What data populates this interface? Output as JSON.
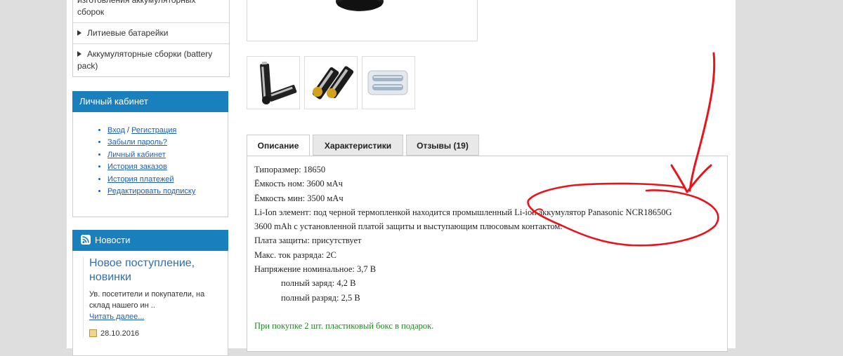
{
  "sidebar": {
    "categories": [
      {
        "label": "изготовления аккумуляторных сборок"
      },
      {
        "label": "Литиевые батарейки"
      },
      {
        "label": "Аккумуляторные сборки (battery pack)"
      }
    ],
    "account": {
      "title": "Личный кабинет",
      "login": "Вход",
      "separator": "/",
      "register": "Регистрация",
      "links": [
        "Забыли пароль?",
        "Личный кабинет",
        "История заказов",
        "История платежей",
        "Редактировать подписку"
      ]
    },
    "news": {
      "title": "Новости",
      "item_title": "Новое поступление, новинки",
      "item_text": "Ув. посетители и покупатели, на склад нашего ин ..",
      "read_more": "Читать далее...",
      "date": "28.10.2016"
    }
  },
  "product": {
    "tabs": [
      {
        "label": "Описание",
        "active": true
      },
      {
        "label": "Характеристики",
        "active": false
      },
      {
        "label": "Отзывы (19)",
        "active": false
      }
    ],
    "description": {
      "size": "Типоразмер: 18650",
      "cap_nom": "Ёмкость ном: 3600 мАч",
      "cap_min": "Ёмкость мин: 3500 мАч",
      "element_1": "Li-Ion элемент: под черной термопленкой находится промышленный Li-ion аккумулятор Panasonic NCR18650G",
      "element_2": "3600 mAh с установленной платой защиты и выступающим плюсовым контактом.",
      "protection": "Плата защиты: присутствует",
      "max_current": "Макс. ток разряда: 2С",
      "voltage": "Напряжение номинальное: 3,7 В",
      "full_charge": "полный заряд: 4,2 В",
      "full_discharge": "полный разряд: 2,5 В",
      "promo": "При покупке 2 шт. пластиковый бокс в подарок."
    }
  },
  "colors": {
    "accent": "#1a7fbd",
    "link": "#1c5fb0",
    "promo": "#1c8a1c",
    "annotation": "#e8141a"
  }
}
